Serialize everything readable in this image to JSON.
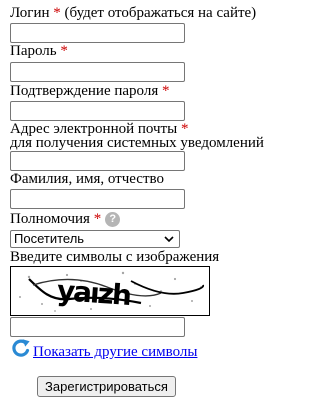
{
  "form": {
    "login": {
      "label": "Логин",
      "required_mark": "*",
      "note": "(будет отображаться на сайте)",
      "value": ""
    },
    "password": {
      "label": "Пароль",
      "required_mark": "*",
      "value": ""
    },
    "password_confirm": {
      "label": "Подтверждение пароля",
      "required_mark": "*",
      "value": ""
    },
    "email": {
      "label": "Адрес электронной почты",
      "required_mark": "*",
      "label_line2": "для получения системных уведомлений",
      "value": ""
    },
    "full_name": {
      "label": "Фамилия, имя, отчество",
      "value": ""
    },
    "role": {
      "label": "Полномочия",
      "required_mark": "*",
      "help_icon": "question-circle-icon",
      "help_symbol": "?",
      "selected": "Посетитель",
      "arrow_icon": "chevron-down-icon"
    },
    "captcha": {
      "label": "Введите символы с изображения",
      "image_text": "yaızh",
      "value": ""
    },
    "refresh_link": {
      "icon": "refresh-icon",
      "label": "Показать другие символы"
    },
    "submit_label": "Зарегистрироваться"
  },
  "colors": {
    "required": "#cc0000",
    "link": "#0000ee",
    "refresh_icon": "#2a8ad4"
  }
}
